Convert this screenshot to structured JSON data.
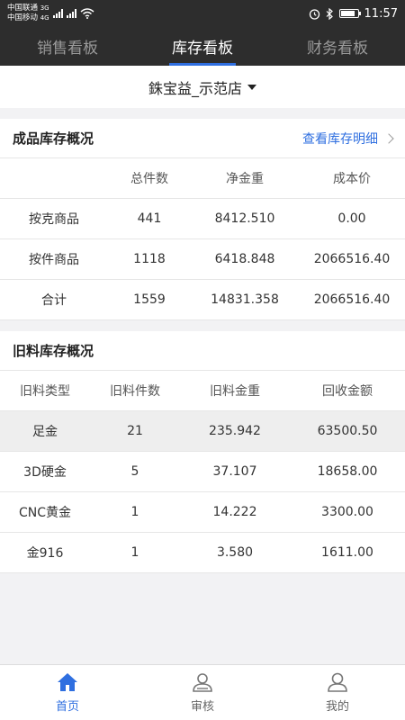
{
  "status_bar": {
    "carrier1": "中国联通",
    "carrier1_net": "3G",
    "carrier2": "中国移动",
    "carrier2_net": "4G",
    "time": "11:57"
  },
  "tabs": [
    {
      "label": "销售看板",
      "active": false
    },
    {
      "label": "库存看板",
      "active": true
    },
    {
      "label": "财务看板",
      "active": false
    }
  ],
  "store_selector": {
    "label": "銖宝益_示范店"
  },
  "finished_inventory": {
    "title": "成品库存概况",
    "link": "查看库存明细",
    "headers": [
      "",
      "总件数",
      "净金重",
      "成本价"
    ],
    "rows": [
      [
        "按克商品",
        "441",
        "8412.510",
        "0.00"
      ],
      [
        "按件商品",
        "1118",
        "6418.848",
        "2066516.40"
      ],
      [
        "合计",
        "1559",
        "14831.358",
        "2066516.40"
      ]
    ]
  },
  "scrap_inventory": {
    "title": "旧料库存概况",
    "headers": [
      "旧料类型",
      "旧料件数",
      "旧料金重",
      "回收金额"
    ],
    "rows": [
      [
        "足金",
        "21",
        "235.942",
        "63500.50"
      ],
      [
        "3D硬金",
        "5",
        "37.107",
        "18658.00"
      ],
      [
        "CNC黄金",
        "1",
        "14.222",
        "3300.00"
      ],
      [
        "金916",
        "1",
        "3.580",
        "1611.00"
      ]
    ]
  },
  "bottom_nav": [
    {
      "label": "首页",
      "icon": "home-icon",
      "active": true
    },
    {
      "label": "审核",
      "icon": "review-user-icon",
      "active": false
    },
    {
      "label": "我的",
      "icon": "profile-icon",
      "active": false
    }
  ],
  "colors": {
    "accent": "#2f6fe0",
    "header_bg": "#2d2d2d"
  }
}
